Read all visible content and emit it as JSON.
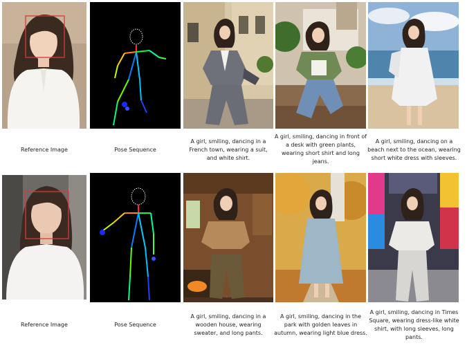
{
  "rows": [
    {
      "captions": [
        "Reference Image",
        "Pose Sequence",
        "A girl, smiling, dancing in a French town, wearing a suit, and white shirt.",
        "A girl, smiling, dancing in front of a desk with green plants, wearing short shirt and long jeans.",
        "A girl, smiling, dancing on a beach next to the ocean, wearing short white dress with sleeves."
      ]
    },
    {
      "captions": [
        "Reference Image",
        "Pose Sequence",
        "A girl, smiling, dancing in a wooden house, wearing sweater, and long pants.",
        "A girl, smiling, dancing in the park with golden leaves in autumn, wearing light blue dress.",
        "A girl, smiling, dancing in Times Square, wearing dress-like white shirt, with long sleeves, long pants."
      ]
    }
  ],
  "colors": {
    "face_box": "#d6393a",
    "pose_background": "#000000"
  }
}
